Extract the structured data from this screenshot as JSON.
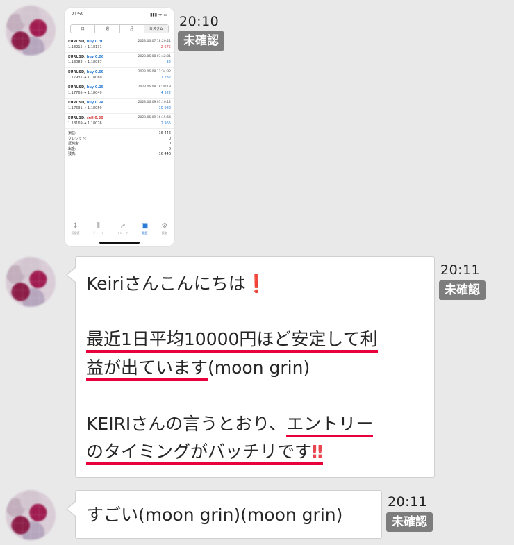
{
  "messages": [
    {
      "time": "20:10",
      "status": "未確認",
      "screenshot": {
        "clock": "21:59",
        "signal": "▮▮▮ ᯤ ▭",
        "tabs": [
          "日",
          "週",
          "月",
          "カスタム"
        ],
        "trades": [
          {
            "symbol": "EURUSD,",
            "side": "buy 0.30",
            "datetime": "2023.06.07 18:20:21",
            "prices": "1.18215 → 1.18131",
            "profit": "-2 675",
            "profit_color": "red"
          },
          {
            "symbol": "EURUSD,",
            "side": "buy 0.06",
            "datetime": "2023.06.08 03:42:01",
            "prices": "1.18082 → 1.18087",
            "profit": "32",
            "profit_color": "blue"
          },
          {
            "symbol": "EURUSD,",
            "side": "buy 0.09",
            "datetime": "2023.06.08 12:34:32",
            "prices": "1.17931 → 1.18060",
            "profit": "1 232",
            "profit_color": "blue"
          },
          {
            "symbol": "EURUSD,",
            "side": "buy 0.15",
            "datetime": "2023.06.08 18:30:18",
            "prices": "1.17765 → 1.18049",
            "profit": "4 522",
            "profit_color": "blue"
          },
          {
            "symbol": "EURUSD,",
            "side": "buy 0.24",
            "datetime": "2023.06.09 01:10:12",
            "prices": "1.17631 → 1.18059",
            "profit": "10 982",
            "profit_color": "blue"
          },
          {
            "symbol": "EURUSD,",
            "side": "sell 0.30",
            "datetime": "2023.06.09 16:15:54",
            "prices": "1.18169 → 1.18076",
            "profit": "2 965",
            "profit_color": "blue"
          }
        ],
        "summary": [
          {
            "label": "損益:",
            "value": "16 446"
          },
          {
            "label": "クレジット:",
            "value": "0"
          },
          {
            "label": "証拠金:",
            "value": "0"
          },
          {
            "label": "出金:",
            "value": "0"
          },
          {
            "label": "残高:",
            "value": "16 446"
          }
        ],
        "nav": [
          "気配値",
          "チャート",
          "トレード",
          "履歴",
          "設定"
        ]
      }
    },
    {
      "time": "20:11",
      "status": "未確認",
      "lines": [
        "Keiriさんこんにちは",
        "最近1日平均10000円ほど安定して利",
        "益が出ています",
        "(moon grin)",
        "KEIRIさんの言うとおり、",
        "エントリー",
        "のタイミングがバッチリです"
      ],
      "emoji_single": "❗",
      "emoji_double": "‼"
    },
    {
      "time": "20:11",
      "status": "未確認",
      "text": "すごい(moon grin)(moon grin)"
    }
  ]
}
